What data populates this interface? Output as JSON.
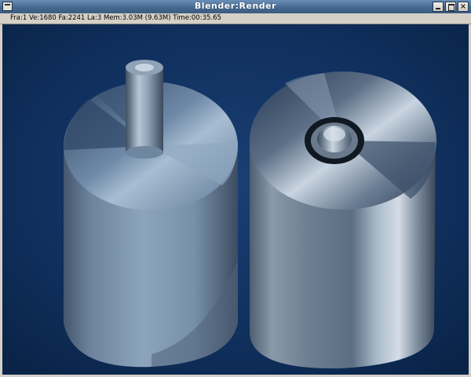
{
  "window": {
    "title": "Blender:Render",
    "system_menu_icon": "window-menu-icon",
    "buttons": {
      "minimize": {
        "icon": "minimize-icon"
      },
      "maximize": {
        "icon": "maximize-icon"
      },
      "close": {
        "label": "×",
        "icon": "close-icon"
      }
    }
  },
  "status": {
    "text": "Fra:1  Ve:1680 Fa:2241  La:3  Mem:3.03M (9.63M) Time:00:35.65"
  },
  "colors": {
    "background": "#0e2d5a",
    "titlebar": "#46698f",
    "chrome": "#d4d0c8"
  }
}
